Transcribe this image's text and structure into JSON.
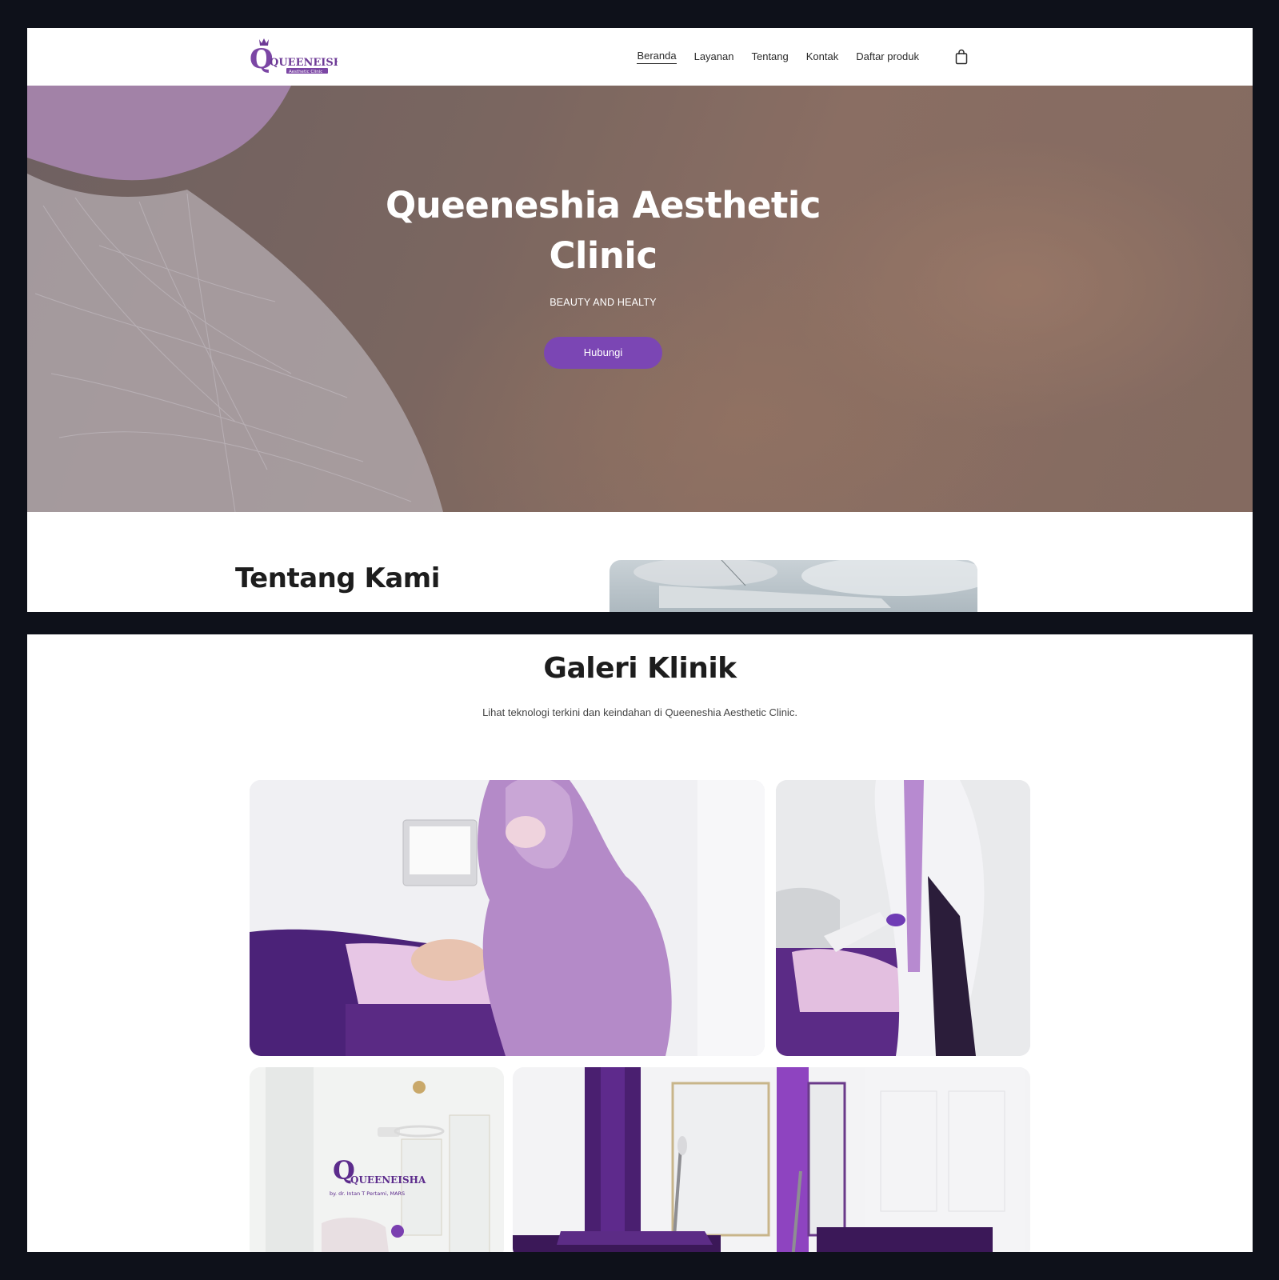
{
  "header": {
    "logo_text": "QUEENEISHA",
    "logo_subtext": "Aesthetic Clinic",
    "nav": [
      {
        "label": "Beranda",
        "active": true
      },
      {
        "label": "Layanan",
        "active": false
      },
      {
        "label": "Tentang",
        "active": false
      },
      {
        "label": "Kontak",
        "active": false
      },
      {
        "label": "Daftar produk",
        "active": false
      }
    ],
    "cart_icon": "shopping-bag-icon"
  },
  "hero": {
    "title_line1": "Queeneshia Aesthetic",
    "title_line2": "Clinic",
    "subtitle": "BEAUTY AND HEALTY",
    "button_label": "Hubungi"
  },
  "about": {
    "title": "Tentang Kami"
  },
  "gallery": {
    "title": "Galeri Klinik",
    "description": "Lihat teknologi terkini dan keindahan di Queeneshia Aesthetic Clinic.",
    "photo_3_sign": "QUEENEISHA",
    "photo_3_sign_sub": "by. dr. Intan T Pertami, MARS"
  },
  "colors": {
    "brand_purple": "#7b46b4",
    "background_dark": "#0e111a"
  }
}
